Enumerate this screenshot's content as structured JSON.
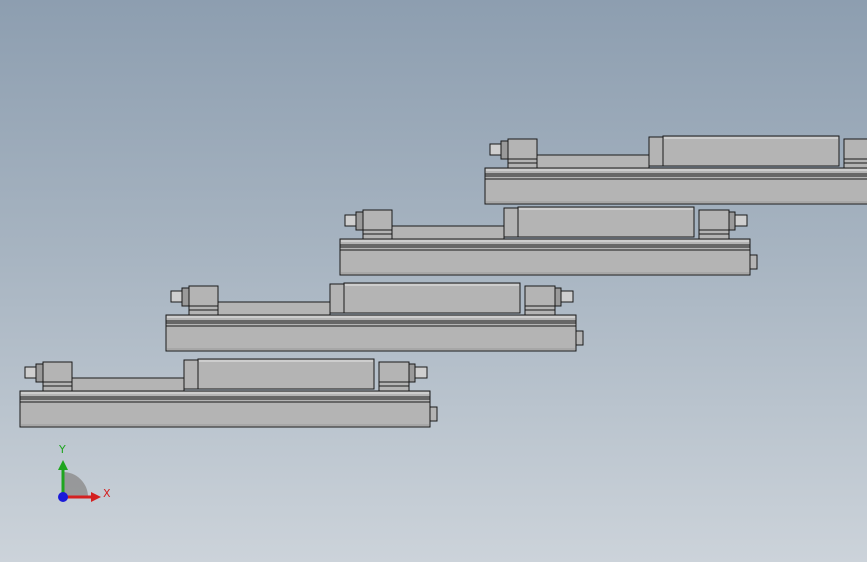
{
  "viewport": {
    "background_top": "#8d9eb0",
    "background_bottom": "#ccd3da"
  },
  "model": {
    "part_count": 4,
    "colors": {
      "body": "#b4b4b4",
      "body_dark": "#9a9a9a",
      "edge": "#1a1a1a",
      "highlight": "#e6e6e6",
      "shaft": "#cfcfcf"
    }
  },
  "triad": {
    "x_label": "X",
    "y_label": "Y",
    "x_color": "#d42020",
    "y_color": "#1fa51f",
    "z_color": "#1a1ad8"
  }
}
